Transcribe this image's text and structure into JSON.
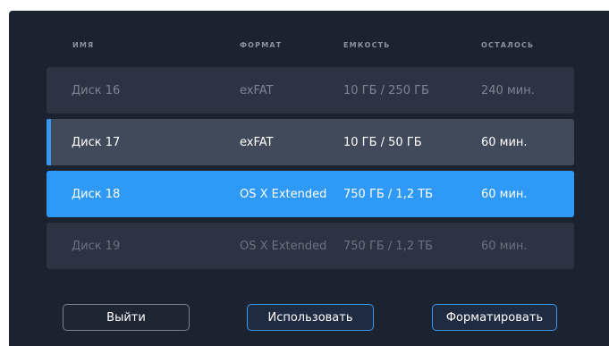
{
  "columns": {
    "name": "ИМЯ",
    "format": "ФОРМАТ",
    "capacity": "ЕМКОСТЬ",
    "remaining": "ОСТАЛОСЬ"
  },
  "disks": [
    {
      "name": "Диск 16",
      "format": "exFAT",
      "capacity": "10 ГБ / 250 ГБ",
      "remaining": "240 мин."
    },
    {
      "name": "Диск 17",
      "format": "exFAT",
      "capacity": "10 ГБ / 50 ГБ",
      "remaining": "60 мин."
    },
    {
      "name": "Диск 18",
      "format": "OS X Extended",
      "capacity": "750 ГБ / 1,2 ТБ",
      "remaining": "60 мин."
    },
    {
      "name": "Диск 19",
      "format": "OS X Extended",
      "capacity": "750 ГБ / 1,2 ТБ",
      "remaining": "60 мин."
    }
  ],
  "buttons": {
    "exit": "Выйти",
    "use": "Использовать",
    "format": "Форматировать"
  },
  "colors": {
    "background": "#1b2230",
    "row": "#2c3443",
    "active_row": "#414a5b",
    "selected_row": "#2e99f7",
    "accent": "#3a97f0"
  }
}
